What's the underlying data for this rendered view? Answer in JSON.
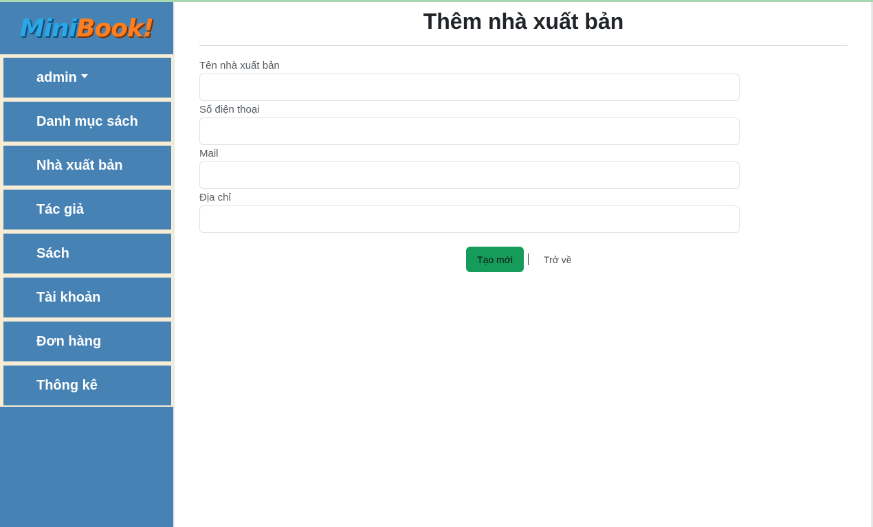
{
  "brand": {
    "part1": "Mini",
    "part2": "Book!"
  },
  "sidebar": {
    "items": [
      {
        "label": "admin",
        "has_caret": true
      },
      {
        "label": "Danh mục sách"
      },
      {
        "label": "Nhà xuất bản"
      },
      {
        "label": "Tác giả"
      },
      {
        "label": "Sách"
      },
      {
        "label": "Tài khoản"
      },
      {
        "label": "Đơn hàng"
      },
      {
        "label": "Thông kê"
      }
    ]
  },
  "page": {
    "title": "Thêm nhà xuất bản"
  },
  "form": {
    "fields": [
      {
        "label": "Tên nhà xuất bản",
        "value": ""
      },
      {
        "label": "Số điện thoại",
        "value": ""
      },
      {
        "label": "Mail",
        "value": ""
      },
      {
        "label": "Địa chỉ",
        "value": ""
      }
    ],
    "submit_label": "Tạo mới",
    "back_label": "Trở về"
  },
  "colors": {
    "sidebar_bg": "#4682b4",
    "menu_frame": "#f7ecd4",
    "submit_bg": "#169c5a"
  }
}
